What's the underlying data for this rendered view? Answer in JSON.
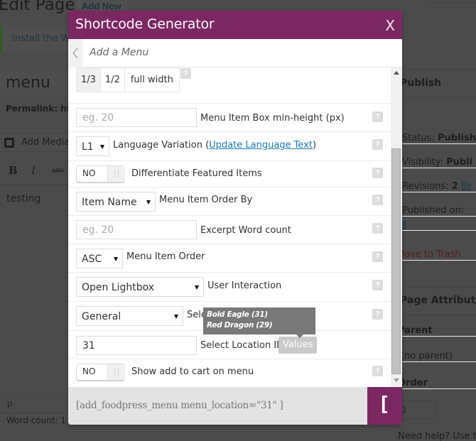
{
  "background": {
    "page_title": "Edit Page",
    "add_new": "Add New",
    "notice_text": "Install the Wo",
    "post_title": "menu",
    "permalink_label": "Permalink: htt",
    "add_media": "Add Media",
    "format_bold": "B",
    "format_italic": "I",
    "format_strike": "ABC",
    "editor_text": "testing",
    "path": "P",
    "word_count": "Word count: 1",
    "sidebar": {
      "publish_header": "Publish",
      "status_label": "Status:",
      "status_value": "Publish",
      "visibility_label": "Visibility:",
      "visibility_value": "Publi",
      "revisions_label": "Revisions:",
      "revisions_value": "2",
      "revisions_link": "Br",
      "published_on": "Published on:",
      "edit_link": "dit",
      "trash_link": "Move to Trash",
      "page_attributes_header": "Page Attributes",
      "parent_label": "Parent",
      "parent_value": "(no parent)",
      "order_label": "Order",
      "order_value": "0",
      "help_text": "Need help? Use th"
    }
  },
  "modal": {
    "title": "Shortcode Generator",
    "close_label": "X",
    "subtitle": "Add a Menu",
    "width_options": [
      {
        "label": "1/3",
        "active": true
      },
      {
        "label": "1/2",
        "active": false
      },
      {
        "label": "full width",
        "active": false
      }
    ],
    "help_label": "?",
    "fields": {
      "min_height": {
        "placeholder": "eg. 20",
        "value": "",
        "label": "Menu Item Box min-height (px)"
      },
      "language": {
        "value": "L1",
        "label_prefix": "Language Variation (",
        "link": "Update Language Text",
        "label_suffix": ")"
      },
      "differentiate": {
        "value": "NO",
        "label": "Differentiate Featured Items"
      },
      "order_by": {
        "value": "Item Name",
        "label": "Menu Item Order By"
      },
      "excerpt": {
        "placeholder": "eg. 20",
        "value": "",
        "label": "Excerpt Word count"
      },
      "order": {
        "value": "ASC",
        "label": "Menu Item Order"
      },
      "interaction": {
        "value": "Open Lightbox",
        "label": "User Interaction"
      },
      "type": {
        "value": "General",
        "label": "Sele"
      },
      "location": {
        "value": "31",
        "label": "Select Location ID",
        "values_button": "Values"
      },
      "add_to_cart": {
        "value": "NO",
        "label": "Show add to cart on menu"
      }
    },
    "tooltip": [
      "Bold Eagle (31)",
      "Red Dragon (29)"
    ],
    "shortcode": "[add_foodpress_menu menu_location=\"31\" ]",
    "generate_button": "[ ]"
  },
  "colors": {
    "brand": "#7b2762",
    "link": "#1a7ab5",
    "tooltip": "#787878"
  }
}
